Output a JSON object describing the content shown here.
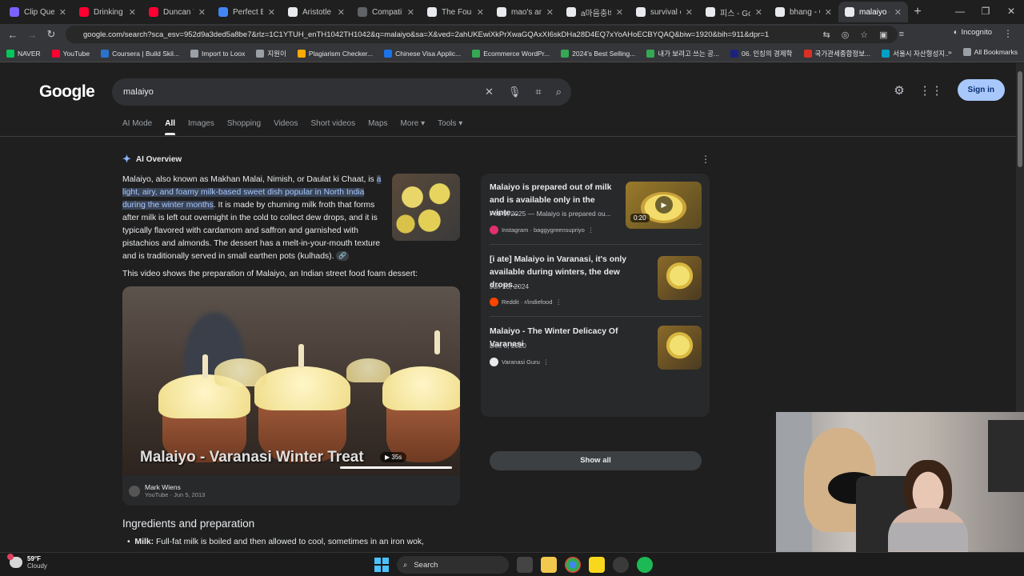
{
  "tabs": [
    {
      "title": "Clip Queue",
      "color": "#7b61ff",
      "active": false
    },
    {
      "title": "Drinking T",
      "color": "#ff0033",
      "active": false
    },
    {
      "title": "Duncan Tr",
      "color": "#ff0033",
      "active": false
    },
    {
      "title": "Perfect Blu",
      "color": "#4285f4",
      "active": false
    },
    {
      "title": "Aristotle a",
      "color": "#e8eaed",
      "active": false
    },
    {
      "title": "Compatib",
      "color": "#5f6368",
      "active": false
    },
    {
      "title": "The Four A",
      "color": "#e8eaed",
      "active": false
    },
    {
      "title": "mao's ame",
      "color": "#e8eaed",
      "active": false
    },
    {
      "title": "a마음충비",
      "color": "#e8eaed",
      "active": false
    },
    {
      "title": "survival of",
      "color": "#e8eaed",
      "active": false
    },
    {
      "title": "피스 - Goo",
      "color": "#e8eaed",
      "active": false
    },
    {
      "title": "bhang - G",
      "color": "#e8eaed",
      "active": false
    },
    {
      "title": "malaiyo - G",
      "color": "#e8eaed",
      "active": true
    }
  ],
  "address": "google.com/search?sca_esv=952d9a3ded5a8be7&rlz=1C1YTUH_enTH1042TH1042&q=malaiyo&sa=X&ved=2ahUKEwiXkPrXwaGQAxXI6skDHa28D4EQ7xYoAHoECBYQAQ&biw=1920&bih=911&dpr=1",
  "incognito_label": "Incognito",
  "bookmarks": [
    {
      "label": "NAVER",
      "color": "#03c75a"
    },
    {
      "label": "YouTube",
      "color": "#ff0033"
    },
    {
      "label": "Coursera | Build Skil...",
      "color": "#2a73cc"
    },
    {
      "label": "Import to Loox",
      "color": "#9aa0a6"
    },
    {
      "label": "지원이",
      "color": "#9aa0a6"
    },
    {
      "label": "Plagiarism Checker...",
      "color": "#f9ab00"
    },
    {
      "label": "Chinese Visa Applic...",
      "color": "#1a73e8"
    },
    {
      "label": "Ecommerce WordPr...",
      "color": "#34a853"
    },
    {
      "label": "2024's Best Selling...",
      "color": "#34a853"
    },
    {
      "label": "내가 보려고 쓰는 공...",
      "color": "#34a853"
    },
    {
      "label": "06. 인칭의 경제학",
      "color": "#1a237e"
    },
    {
      "label": "국가관세종합정보...",
      "color": "#d93025"
    },
    {
      "label": "서울시 자산형성지...",
      "color": "#00a0c6"
    }
  ],
  "bookmarks_more": "»",
  "all_bookmarks": "All Bookmarks",
  "logo": "Google",
  "query": "malaiyo",
  "signin": "Sign in",
  "search_tabs": [
    "AI Mode",
    "All",
    "Images",
    "Shopping",
    "Videos",
    "Short videos",
    "Maps",
    "More ▾",
    "Tools ▾"
  ],
  "ai_overview": {
    "title": "AI Overview",
    "text_a": "Malaiyo, also known as Makhan Malai, Nimish, or Daulat ki Chaat, is ",
    "text_hl": "a light, airy, and foamy milk-based sweet dish popular in North India during the winter months",
    "text_b": ". It is made by churning milk froth that forms after milk is left out overnight in the cold to collect dew drops, and it is typically flavored with cardamom and saffron and garnished with pistachios and almonds. The dessert has a melt-in-your-mouth texture and is traditionally served in small earthen pots (kulhads).",
    "video_caption": "This video shows the preparation of Malaiyo, an Indian street food foam dessert:",
    "video_title": "Malaiyo - Varanasi Winter Treat",
    "video_duration": "▶ 35s",
    "channel": "Mark Wiens",
    "channel_meta": "YouTube · Jun 5, 2013"
  },
  "section_heading": "Ingredients and preparation",
  "bullet_label": "Milk:",
  "bullet_text": " Full-fat milk is boiled and then allowed to cool, sometimes in an iron wok,",
  "sources": [
    {
      "title": "Malaiyo is prepared out of milk and is available only in the winte...",
      "date": "Feb 9, 2025 — Malaiyo is prepared ou...",
      "source": "Instagram · baggygreensupriyo",
      "color": "#e1306c",
      "duration": "0:20"
    },
    {
      "title": "[i ate] Malaiyo in Varanasi, it's only available during winters, the dew drops...",
      "date": "Jun 23, 2024",
      "source": "Reddit · r/indiefood",
      "color": "#ff4500"
    },
    {
      "title": "Malaiyo - The Winter Delicacy Of Varanasi",
      "date": "Dec 8, 2020",
      "source": "Varanasi Guru",
      "color": "#e8eaed"
    }
  ],
  "show_all": "Show all",
  "weather": {
    "temp": "59°F",
    "cond": "Cloudy"
  },
  "taskbar_search": "Search"
}
